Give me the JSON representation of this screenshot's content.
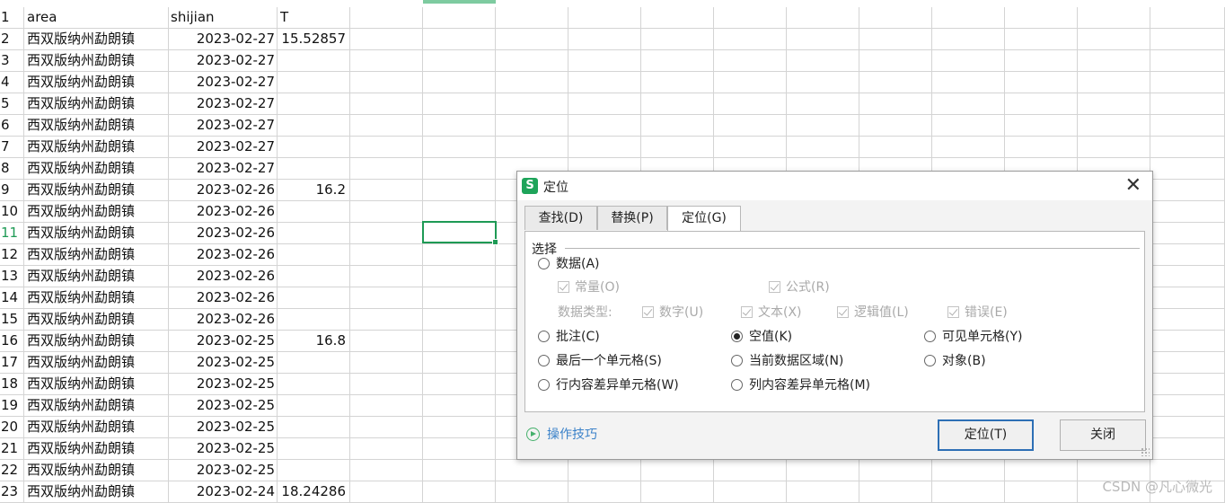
{
  "sheet": {
    "headers": {
      "row": "1",
      "area": "area",
      "date": "shijian",
      "t": "T"
    },
    "rows": [
      {
        "num": "2",
        "area": "西双版纳州勐朗镇",
        "date": "2023-02-27",
        "t": "15.52857"
      },
      {
        "num": "3",
        "area": "西双版纳州勐朗镇",
        "date": "2023-02-27",
        "t": ""
      },
      {
        "num": "4",
        "area": "西双版纳州勐朗镇",
        "date": "2023-02-27",
        "t": ""
      },
      {
        "num": "5",
        "area": "西双版纳州勐朗镇",
        "date": "2023-02-27",
        "t": ""
      },
      {
        "num": "6",
        "area": "西双版纳州勐朗镇",
        "date": "2023-02-27",
        "t": ""
      },
      {
        "num": "7",
        "area": "西双版纳州勐朗镇",
        "date": "2023-02-27",
        "t": ""
      },
      {
        "num": "8",
        "area": "西双版纳州勐朗镇",
        "date": "2023-02-27",
        "t": ""
      },
      {
        "num": "9",
        "area": "西双版纳州勐朗镇",
        "date": "2023-02-26",
        "t": "16.2"
      },
      {
        "num": "10",
        "area": "西双版纳州勐朗镇",
        "date": "2023-02-26",
        "t": ""
      },
      {
        "num": "11",
        "area": "西双版纳州勐朗镇",
        "date": "2023-02-26",
        "t": ""
      },
      {
        "num": "12",
        "area": "西双版纳州勐朗镇",
        "date": "2023-02-26",
        "t": ""
      },
      {
        "num": "13",
        "area": "西双版纳州勐朗镇",
        "date": "2023-02-26",
        "t": ""
      },
      {
        "num": "14",
        "area": "西双版纳州勐朗镇",
        "date": "2023-02-26",
        "t": ""
      },
      {
        "num": "15",
        "area": "西双版纳州勐朗镇",
        "date": "2023-02-26",
        "t": ""
      },
      {
        "num": "16",
        "area": "西双版纳州勐朗镇",
        "date": "2023-02-25",
        "t": "16.8"
      },
      {
        "num": "17",
        "area": "西双版纳州勐朗镇",
        "date": "2023-02-25",
        "t": ""
      },
      {
        "num": "18",
        "area": "西双版纳州勐朗镇",
        "date": "2023-02-25",
        "t": ""
      },
      {
        "num": "19",
        "area": "西双版纳州勐朗镇",
        "date": "2023-02-25",
        "t": ""
      },
      {
        "num": "20",
        "area": "西双版纳州勐朗镇",
        "date": "2023-02-25",
        "t": ""
      },
      {
        "num": "21",
        "area": "西双版纳州勐朗镇",
        "date": "2023-02-25",
        "t": ""
      },
      {
        "num": "22",
        "area": "西双版纳州勐朗镇",
        "date": "2023-02-25",
        "t": ""
      },
      {
        "num": "23",
        "area": "西双版纳州勐朗镇",
        "date": "2023-02-24",
        "t": "18.24286"
      }
    ],
    "active_row": "11",
    "active_color": "#1e9a55"
  },
  "dialog": {
    "title": "定位",
    "app_icon": "S",
    "close_glyph": "✕",
    "tabs": [
      "查找(D)",
      "替换(P)",
      "定位(G)"
    ],
    "selected_tab": "定位(G)",
    "section_label": "选择",
    "opt_data": "数据(A)",
    "chk_constant": "常量(O)",
    "chk_formula": "公式(R)",
    "dtype_label": "数据类型:",
    "chk_number": "数字(U)",
    "chk_text": "文本(X)",
    "chk_logical": "逻辑值(L)",
    "chk_error": "错误(E)",
    "opt_comment": "批注(C)",
    "opt_blank": "空值(K)",
    "opt_visible": "可见单元格(Y)",
    "opt_last": "最后一个单元格(S)",
    "opt_region": "当前数据区域(N)",
    "opt_object": "对象(B)",
    "opt_row_diff": "行内容差异单元格(W)",
    "opt_col_diff": "列内容差异单元格(M)",
    "selected_option": "空值(K)",
    "tips": "操作技巧",
    "btn_locate": "定位(T)",
    "btn_close": "关闭"
  },
  "watermark": "CSDN @凡心微光"
}
